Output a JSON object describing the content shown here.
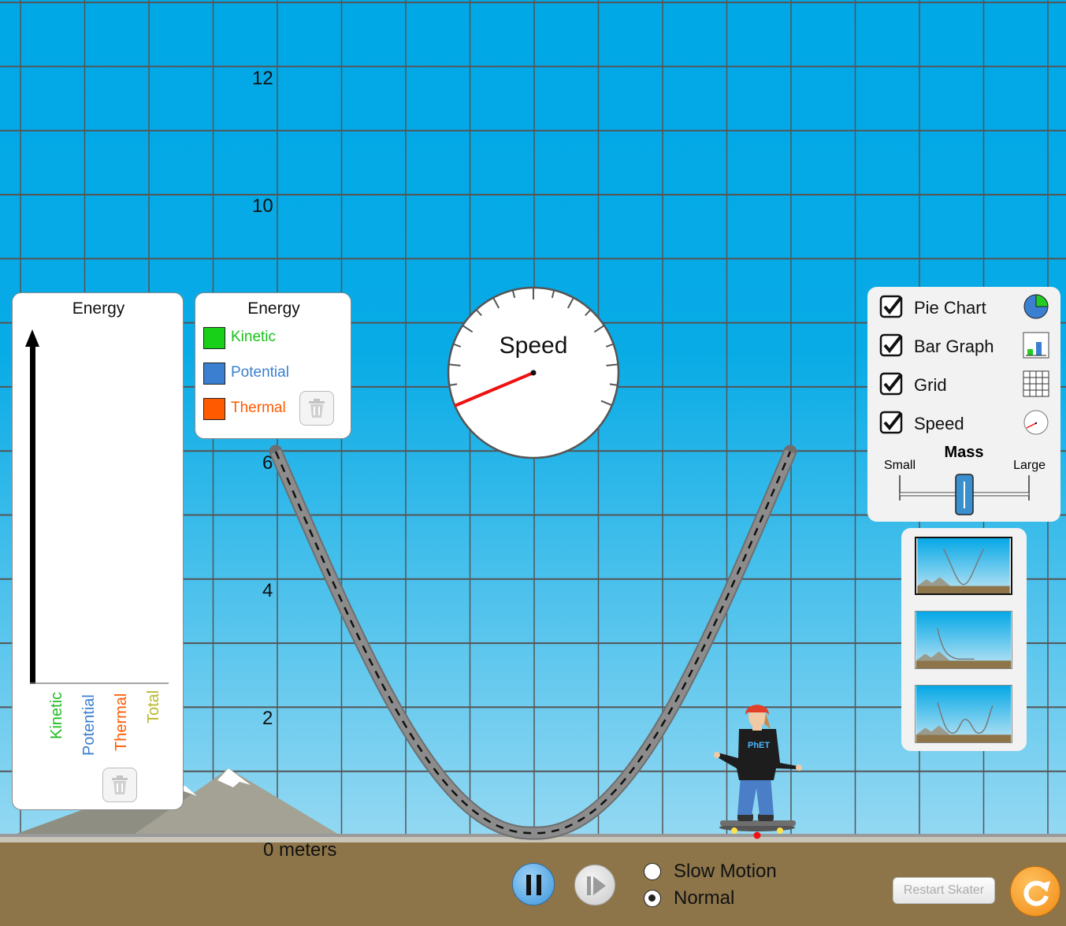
{
  "grid_labels": [
    "12",
    "10",
    "6",
    "4",
    "2",
    "0 meters"
  ],
  "bar_graph": {
    "title": "Energy",
    "categories": [
      {
        "label": "Kinetic",
        "color": "#22bb22"
      },
      {
        "label": "Potential",
        "color": "#3a7fd0"
      },
      {
        "label": "Thermal",
        "color": "#ff5a00"
      },
      {
        "label": "Total",
        "color": "#b7b72a"
      }
    ]
  },
  "pie_legend": {
    "title": "Energy",
    "items": [
      {
        "label": "Kinetic",
        "color": "#18d018"
      },
      {
        "label": "Potential",
        "color": "#3a7fd0"
      },
      {
        "label": "Thermal",
        "color": "#ff5a00"
      }
    ]
  },
  "speedometer": {
    "label": "Speed"
  },
  "controls": {
    "checkboxes": [
      {
        "label": "Pie Chart",
        "checked": true,
        "icon": "pie-chart-icon"
      },
      {
        "label": "Bar Graph",
        "checked": true,
        "icon": "bar-graph-icon"
      },
      {
        "label": "Grid",
        "checked": true,
        "icon": "grid-icon"
      },
      {
        "label": "Speed",
        "checked": true,
        "icon": "speedometer-icon"
      }
    ],
    "mass": {
      "title": "Mass",
      "min_label": "Small",
      "max_label": "Large",
      "value": 0.5
    }
  },
  "tracks": [
    "parabola",
    "ramp",
    "double-well"
  ],
  "selected_track": 0,
  "playback": {
    "slow_motion_label": "Slow Motion",
    "normal_label": "Normal",
    "selected": "normal",
    "restart_label": "Restart Skater"
  },
  "skater_logo": "PhET",
  "colors": {
    "sky_top": "#00a8e6",
    "sky_bottom": "#8ad6f3",
    "ground": "#8d7549",
    "grid": "#555555",
    "orange_button": "#f7941d",
    "blue_button": "#4aa3e6"
  }
}
